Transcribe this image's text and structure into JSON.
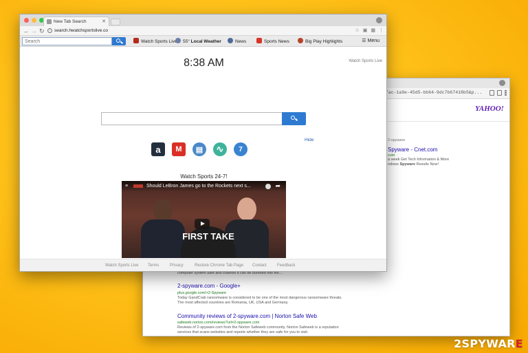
{
  "front_window": {
    "tab": {
      "title": "New Tab Search"
    },
    "address": {
      "url": "search.hwatchsportslive.co"
    },
    "toolbar": {
      "search_placeholder": "Search",
      "items": [
        {
          "label": "Watch Sports Live",
          "icon": "tv-icon",
          "color": "#b52a1d"
        },
        {
          "label": "55° ",
          "bold": "Local Weather",
          "icon": "weather-icon",
          "color": "#6b7fa8"
        },
        {
          "label": "News",
          "icon": "news-icon",
          "color": "#4e6a9a"
        },
        {
          "label": "Sports News",
          "icon": "sports-news-icon",
          "color": "#d8342a"
        },
        {
          "label": "Big Play Highlights",
          "icon": "football-icon",
          "color": "#b5432a"
        }
      ],
      "menu_label": "Menu"
    },
    "page": {
      "clock": "8:38 AM",
      "top_right_link": "Watch Sports Live",
      "hide_link": "Hide",
      "shortcuts": [
        {
          "name": "amazon",
          "glyph": "a",
          "bg": "#232f3e"
        },
        {
          "name": "gmail",
          "glyph": "M",
          "bg": "#d93025"
        },
        {
          "name": "window",
          "glyph": "▤",
          "bg": "#4a89c8"
        },
        {
          "name": "pulse",
          "glyph": "∿",
          "bg": "#3fb39b"
        },
        {
          "name": "calendar",
          "glyph": "7",
          "bg": "#3a83d1"
        }
      ],
      "video_heading": "Watch Sports 24-7!",
      "video": {
        "title": "Should LeBron James go to the Rockets next s...",
        "overlay_text": "FIRST TAKE"
      },
      "footer_links": [
        "Watch Sports Live",
        "Terms",
        "Privacy",
        "Restore Chrome Tab Page",
        "Contact",
        "Feedback"
      ]
    }
  },
  "back_window": {
    "url_fragment": "36fac-1a9e-45d5-bb64-9dc7b67418b5&p...",
    "logo": "YAHOO!",
    "top_results": {
      "label": "2-spyware",
      "title": "Spyware - Cnet.com",
      "cite": "com",
      "line1": "a week Get Tech Information & More",
      "line2_before": "ndows ",
      "line2_bold": "Spyware",
      "line2_after": " Results Now!"
    },
    "results": [
      {
        "snippet_top": "computer system safe and crashes it can be bundled into file...",
        "title": "2-spyware.com - Google+",
        "cite": "plus.google.com/+2-Spyware",
        "line1": "Today GandCrab ransomware is considered to be one of the most dangerous ransomware threats.",
        "line2": "The most affected countries are Romania, UK, USA and Germany."
      },
      {
        "title": "Community reviews of 2-spyware.com | Norton Safe Web",
        "cite": "safeweb.norton.com/reviews?url=2-spyware.com",
        "line1": "Reviews of 2-spyware.com from the Norton Safeweb community. Norton Safeweb is a reputation",
        "line2": "services that scans websites and reports whether they are safe for you to visit."
      }
    ]
  },
  "watermark": {
    "part1": "2SPYWAR",
    "part2": "E"
  }
}
